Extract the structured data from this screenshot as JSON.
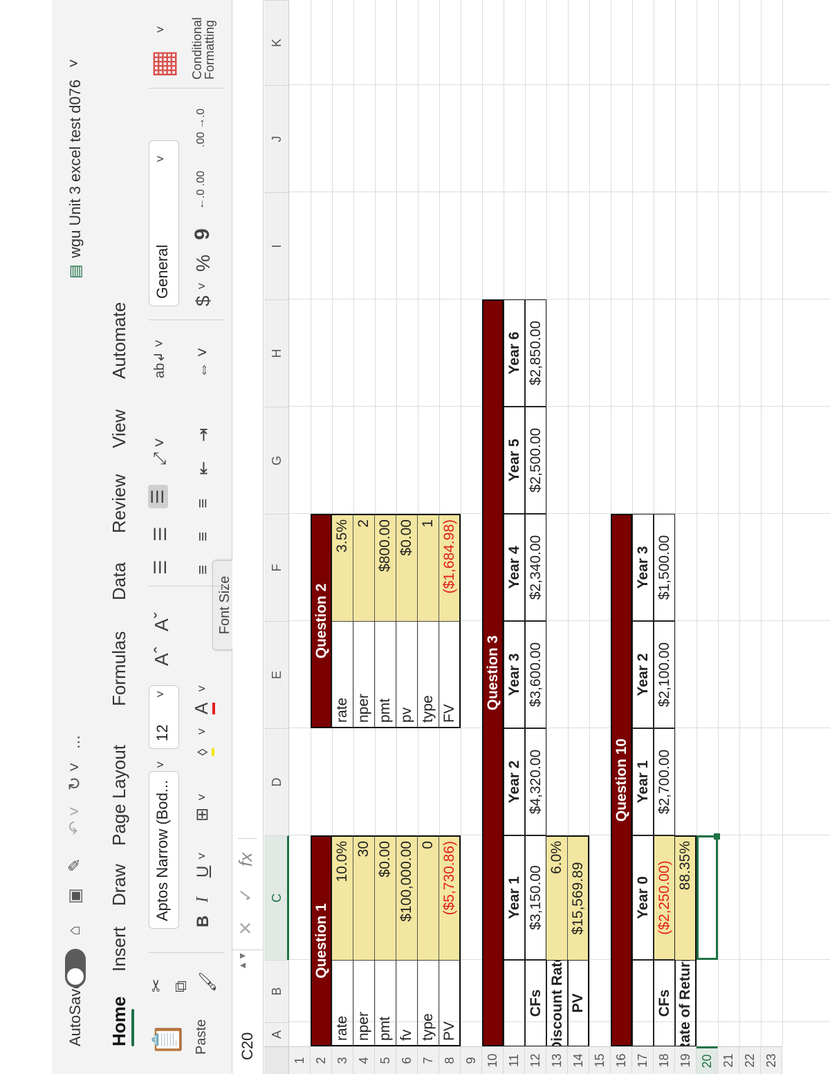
{
  "app": {
    "autosave_label": "AutoSave",
    "file_name": "wgu Unit 3 excel test d076",
    "more": "..."
  },
  "tabs": [
    "Home",
    "Insert",
    "Draw",
    "Page Layout",
    "Formulas",
    "Data",
    "Review",
    "View",
    "Automate"
  ],
  "ribbon": {
    "paste_label": "Paste",
    "font_name": "Aptos Narrow (Bod...",
    "font_size": "12",
    "bold": "B",
    "italic": "I",
    "underline": "U",
    "grow_font": "Aˆ",
    "shrink_font": "Aˇ",
    "font_color": "A",
    "tooltip": "Font Size",
    "number_format": "General",
    "currency": "$",
    "percent": "%",
    "comma": "9",
    "inc_decimal": "←.0 .00",
    "dec_decimal": ".00 →.0",
    "cond_format_line1": "Conditional",
    "cond_format_line2": "Formatting"
  },
  "formula_bar": {
    "name_box": "C20",
    "fx": "fx",
    "cancel": "✕",
    "enter": "✓"
  },
  "columns": [
    "A",
    "B",
    "C",
    "D",
    "E",
    "F",
    "G",
    "H",
    "I",
    "J",
    "K"
  ],
  "rows": [
    "1",
    "2",
    "3",
    "4",
    "5",
    "6",
    "7",
    "8",
    "9",
    "10",
    "11",
    "12",
    "13",
    "14",
    "15",
    "16",
    "17",
    "18",
    "19",
    "20",
    "21",
    "22",
    "23"
  ],
  "q1": {
    "title": "Question 1",
    "rows": [
      {
        "label": "rate",
        "value": "10.0%"
      },
      {
        "label": "nper",
        "value": "30"
      },
      {
        "label": "pmt",
        "value": "$0.00"
      },
      {
        "label": "fv",
        "value": "$100,000.00"
      },
      {
        "label": "type",
        "value": "0"
      },
      {
        "label": "PV",
        "value": "($5,730.86)"
      }
    ]
  },
  "q2": {
    "title": "Question 2",
    "rows": [
      {
        "label": "rate",
        "value": "3.5%"
      },
      {
        "label": "nper",
        "value": "2"
      },
      {
        "label": "pmt",
        "value": "$800.00"
      },
      {
        "label": "pv",
        "value": "$0.00"
      },
      {
        "label": "type",
        "value": "1"
      },
      {
        "label": "FV",
        "value": "($1,684.98)"
      }
    ]
  },
  "q3": {
    "title": "Question 3",
    "headers": [
      "Year 1",
      "Year 2",
      "Year 3",
      "Year 4",
      "Year 5",
      "Year 6"
    ],
    "cfs_label": "CFs",
    "cfs": [
      "$3,150.00",
      "$4,320.00",
      "$3,600.00",
      "$2,340.00",
      "$2,500.00",
      "$2,850.00"
    ],
    "discount_label": "Discount Rate",
    "discount_value": "6.0%",
    "pv_label": "PV",
    "pv_value": "$15,569.89"
  },
  "q10": {
    "title": "Question 10",
    "headers": [
      "Year 0",
      "Year 1",
      "Year 2",
      "Year 3"
    ],
    "cfs_label": "CFs",
    "cfs": [
      "($2,250.00)",
      "$2,700.00",
      "$2,100.00",
      "$1,500.00"
    ],
    "ror_label": "Rate of Return",
    "ror_value": "88.35%"
  },
  "colors": {
    "header_fill": "#7b0000",
    "input_fill": "#f2e6a0",
    "negative_text": "#e02020",
    "selection": "#1e7145"
  }
}
